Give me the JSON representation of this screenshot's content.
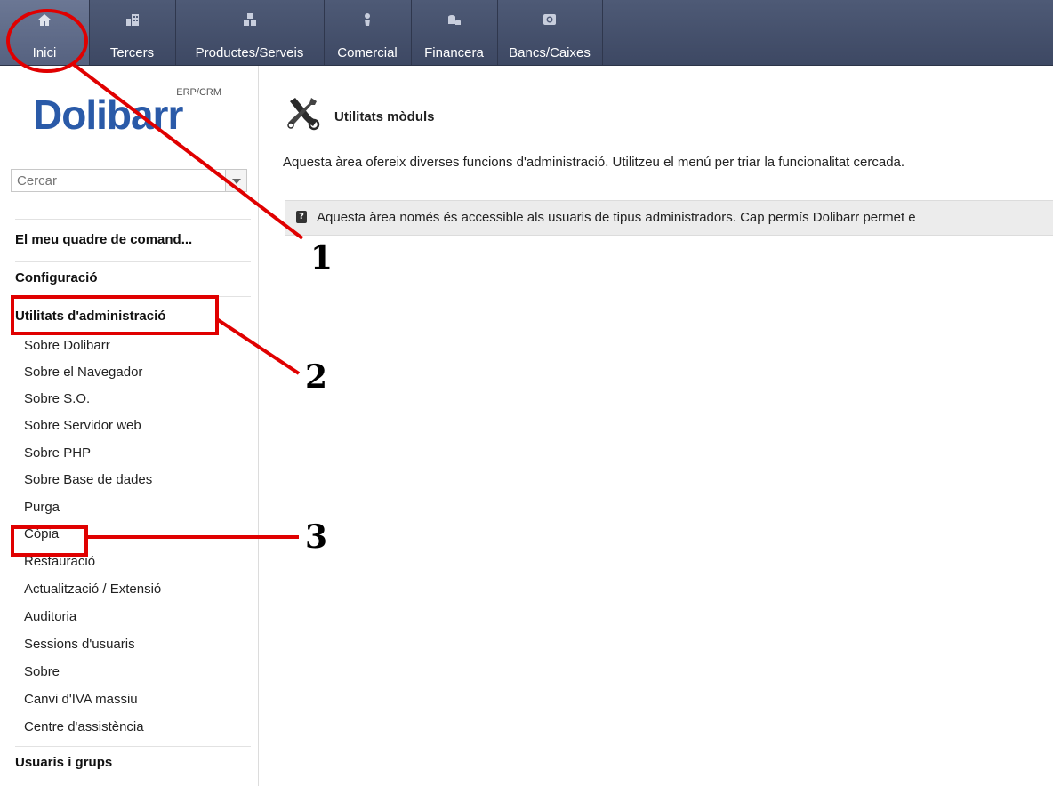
{
  "topbar": {
    "items": [
      {
        "label": "Inici",
        "icon": "home-icon"
      },
      {
        "label": "Tercers",
        "icon": "companies-icon"
      },
      {
        "label": "Productes/Serveis",
        "icon": "products-icon"
      },
      {
        "label": "Comercial",
        "icon": "commercial-icon"
      },
      {
        "label": "Financera",
        "icon": "billing-icon"
      },
      {
        "label": "Bancs/Caixes",
        "icon": "bank-icon"
      }
    ]
  },
  "sidebar": {
    "logo_text": "Dolibarr",
    "logo_sub": "ERP/CRM",
    "search_placeholder": "Cercar",
    "sections": [
      "El meu quadre de comand...",
      "Configuració",
      "Utilitats d'administració",
      "Usuaris i grups"
    ],
    "admin_items": [
      "Sobre Dolibarr",
      "Sobre el Navegador",
      "Sobre S.O.",
      "Sobre Servidor web",
      "Sobre PHP",
      "Sobre Base de dades",
      "Purga",
      "Còpia",
      "Restauració",
      "Actualització / Extensió",
      "Auditoria",
      "Sessions d'usuaris",
      "Sobre",
      "Canvi d'IVA massiu",
      "Centre d'assistència"
    ]
  },
  "main": {
    "title": "Utilitats mòduls",
    "description": "Aquesta àrea ofereix diverses funcions d'administració. Utilitzeu el menú per triar la funcionalitat cercada.",
    "info": "Aquesta àrea només és accessible als usuaris de tipus administradors. Cap permís Dolibarr permet e"
  },
  "annotations": {
    "step1": "1",
    "step2": "2",
    "step3": "3",
    "color": "#e00000"
  },
  "colors": {
    "topbar": "#46516c",
    "logo": "#2a5aa8"
  }
}
